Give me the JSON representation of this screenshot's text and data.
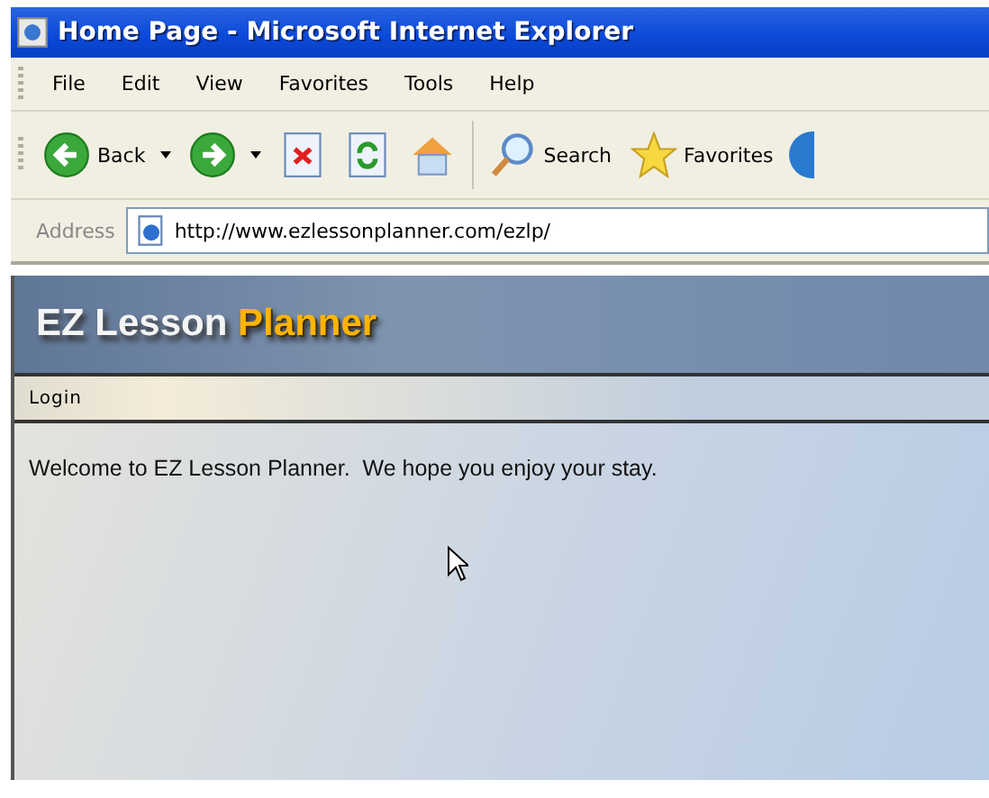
{
  "window": {
    "title": "Home Page - Microsoft Internet Explorer"
  },
  "menu": [
    "File",
    "Edit",
    "View",
    "Favorites",
    "Tools",
    "Help"
  ],
  "toolbar": [
    {
      "kind": "back",
      "label": "Back"
    },
    {
      "kind": "forward"
    },
    {
      "kind": "stop"
    },
    {
      "kind": "refresh"
    },
    {
      "kind": "home"
    },
    {
      "kind": "search",
      "label": "Search"
    },
    {
      "kind": "favorites",
      "label": "Favorites"
    }
  ],
  "address": {
    "label": "Address",
    "value": "http://www.ezlessonplanner.com/ezlp/"
  },
  "page": {
    "logo_main": "EZ Lesson",
    "logo_accent": "Planner",
    "nav": [
      "Login"
    ],
    "welcome": "Welcome to EZ Lesson Planner.  We hope you enjoy your stay."
  }
}
